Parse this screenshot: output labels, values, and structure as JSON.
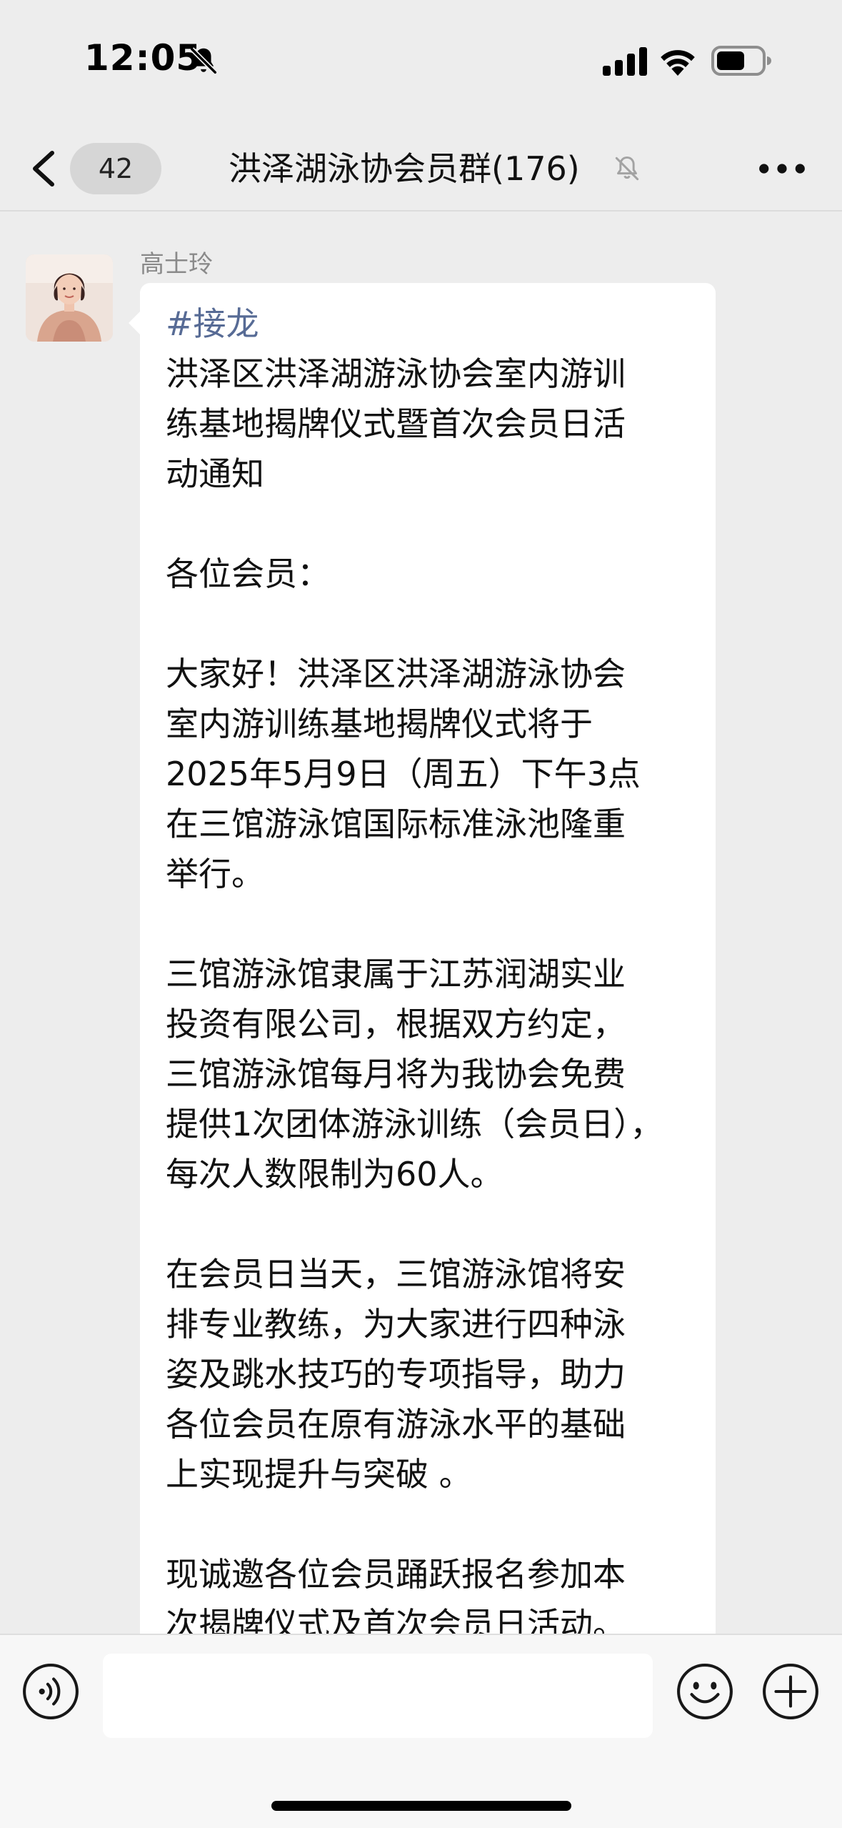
{
  "status_bar": {
    "time": "12:05"
  },
  "header": {
    "unread_count": "42",
    "title": "洪泽湖泳协会员群(176)"
  },
  "message": {
    "sender": "高士玲",
    "hashtag": "#接龙",
    "lines": [
      "洪泽区洪泽湖游泳协会室内游训",
      "练基地揭牌仪式暨首次会员日活",
      "动通知",
      "",
      "各位会员：",
      "",
      "大家好！洪泽区洪泽湖游泳协会",
      "室内游训练基地揭牌仪式将于",
      "2025年5月9日（周五）下午3点",
      "在三馆游泳馆国际标准泳池隆重",
      "举行。",
      "",
      "三馆游泳馆隶属于江苏润湖实业",
      "投资有限公司，根据双方约定，",
      "三馆游泳馆每月将为我协会免费",
      "提供1次团体游泳训练（会员日），",
      "每次人数限制为60人。",
      "",
      "在会员日当天，三馆游泳馆将安",
      "排专业教练，为大家进行四种泳",
      "姿及跳水技巧的专项指导，助力",
      "各位会员在原有游泳水平的基础",
      "上实现提升与突破 。",
      "",
      "现诚邀各位会员踊跃报名参加本",
      "次揭牌仪式及首次会员日活动。"
    ]
  },
  "input_bar": {
    "value": "",
    "placeholder": ""
  },
  "icons": {
    "status": [
      "bell-slash-icon",
      "cellular-signal-icon",
      "wifi-icon",
      "battery-icon"
    ],
    "header": [
      "chevron-left-icon",
      "bell-slash-icon",
      "more-icon"
    ],
    "input": [
      "voice-icon",
      "emoji-icon",
      "plus-icon"
    ]
  },
  "colors": {
    "background": "#ededed",
    "bubble": "#ffffff",
    "hashtag": "#576b95",
    "sender_name": "#8a8a8a"
  }
}
